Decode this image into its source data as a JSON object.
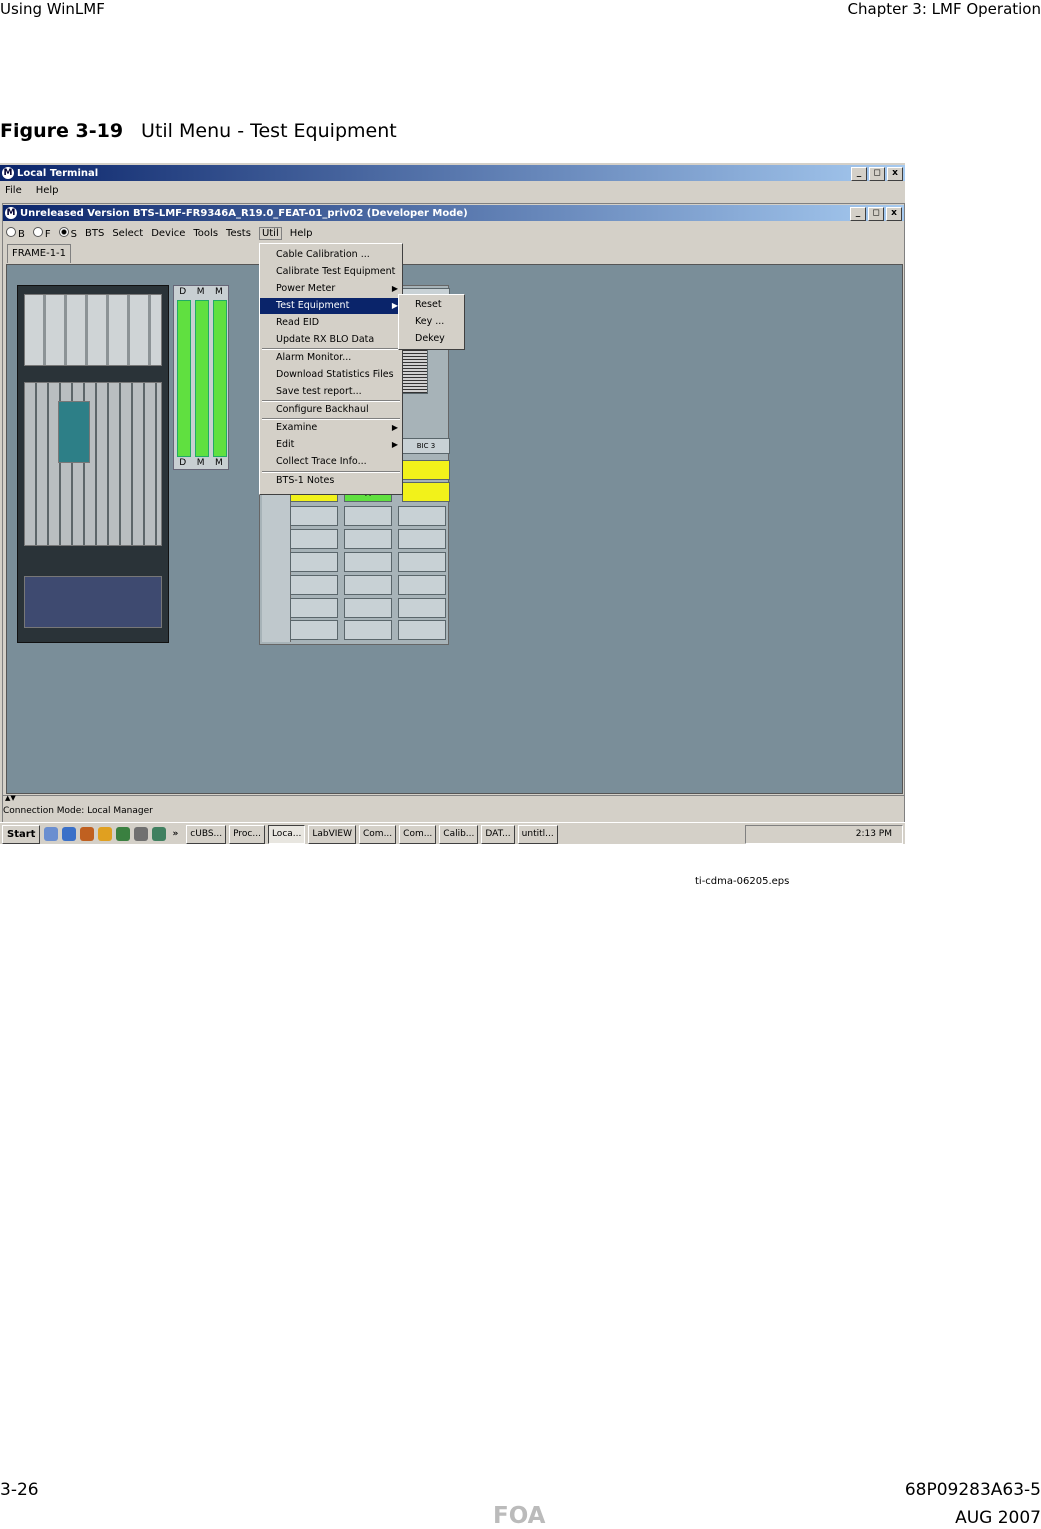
{
  "page_header": {
    "left": "Using WinLMF",
    "right": "Chapter 3: LMF Operation"
  },
  "figure": {
    "number": "Figure 3-19",
    "title": "Util Menu - Test Equipment"
  },
  "outer_window": {
    "title": "Local Terminal",
    "menu": [
      "File",
      "Help"
    ],
    "controls": [
      "_",
      "◻",
      "x"
    ]
  },
  "inner_window": {
    "title": "Unreleased Version BTS-LMF-FR9346A_R19.0_FEAT-01_priv02 (Developer Mode)",
    "radios": [
      {
        "label": "B",
        "selected": false
      },
      {
        "label": "F",
        "selected": false
      },
      {
        "label": "S",
        "selected": true
      }
    ],
    "menu": [
      "BTS",
      "Select",
      "Device",
      "Tools",
      "Tests",
      "Util",
      "Help"
    ],
    "active_menu": "Util",
    "tab": "FRAME-1-1"
  },
  "card_labels": {
    "top": [
      "D",
      "M",
      "M"
    ],
    "bottom": [
      "D",
      "M",
      "M"
    ]
  },
  "grid": {
    "header_cell": "BIC 3",
    "marker": "A"
  },
  "util_menu": {
    "items": [
      "Cable Calibration ...",
      "Calibrate Test Equipment",
      "Power Meter",
      "Test Equipment",
      "Read EID",
      "Update RX BLO Data",
      "Alarm Monitor...",
      "Download Statistics Files",
      "Save test report...",
      "Configure Backhaul",
      "Examine",
      "Edit",
      "Collect Trace Info...",
      "BTS-1 Notes"
    ],
    "selected": "Test Equipment",
    "submenu_arrows": [
      "Power Meter",
      "Test Equipment",
      "Examine",
      "Edit"
    ]
  },
  "submenu": {
    "items": [
      "Reset",
      "Key ...",
      "Dekey"
    ]
  },
  "status_bar": {
    "text": "Connection Mode: Local Manager"
  },
  "taskbar": {
    "start": "Start",
    "chevron": "»",
    "buttons": [
      "cUBS...",
      "Proc...",
      "Loca...",
      "LabVIEW",
      "Com...",
      "Com...",
      "Calib...",
      "DAT...",
      "untitl..."
    ],
    "active": "Loca...",
    "clock": "2:13 PM"
  },
  "image_file": "ti-cdma-06205.eps",
  "footer": {
    "page": "3-26",
    "doc": "68P09283A63-5",
    "mark": "FOA",
    "date": "AUG 2007"
  },
  "colors": {
    "titlebar": "#0a246a",
    "menu_highlight": "#0a246a",
    "canvas": "#7a8e99",
    "card_green": "#60e040",
    "cell_yellow": "#f2f21a"
  }
}
